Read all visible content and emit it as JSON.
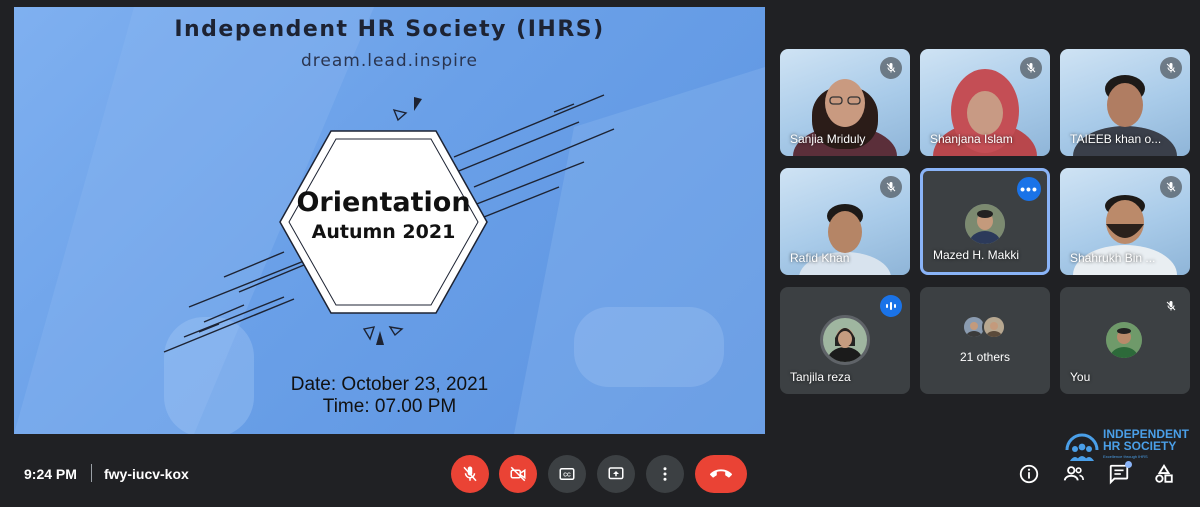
{
  "presentation": {
    "title": "Independent HR Society (IHRS)",
    "tagline": "dream.lead.inspire",
    "hex_line1": "Orientation",
    "hex_line2": "Autumn 2021",
    "date": "Date: October 23, 2021",
    "time": "Time: 07.00 PM"
  },
  "participants": [
    {
      "name": "Sanjia Mriduly",
      "state": "muted"
    },
    {
      "name": "Shanjana Islam",
      "state": "muted"
    },
    {
      "name": "TAIEEB khan o...",
      "state": "muted"
    },
    {
      "name": "Rafid Khan",
      "state": "muted"
    },
    {
      "name": "Mazed H. Makki",
      "state": "pinned"
    },
    {
      "name": "Shahrukh Bin ...",
      "state": "muted"
    },
    {
      "name": "Tanjila reza",
      "state": "speaking"
    },
    {
      "name": "21 others",
      "state": "group"
    },
    {
      "name": "You",
      "state": "muted"
    }
  ],
  "bottom_bar": {
    "time": "9:24 PM",
    "meeting_code": "fwy-iucv-kox",
    "controls": [
      "mic-off-icon",
      "camera-off-icon",
      "captions-icon",
      "present-icon",
      "more-vert-icon",
      "hang-up-icon"
    ],
    "right_icons": [
      "info-icon",
      "people-icon",
      "chat-icon",
      "activities-icon"
    ]
  },
  "logo": {
    "line1": "INDEPENDENT",
    "line2": "HR SOCIETY",
    "tagline": "Excellence through IHRS"
  },
  "colors": {
    "background": "#202124",
    "tile": "#3c4043",
    "danger": "#ea4335",
    "accent": "#8ab4f8",
    "speaking": "#1a73e8",
    "slide": "#6aa0e8"
  }
}
